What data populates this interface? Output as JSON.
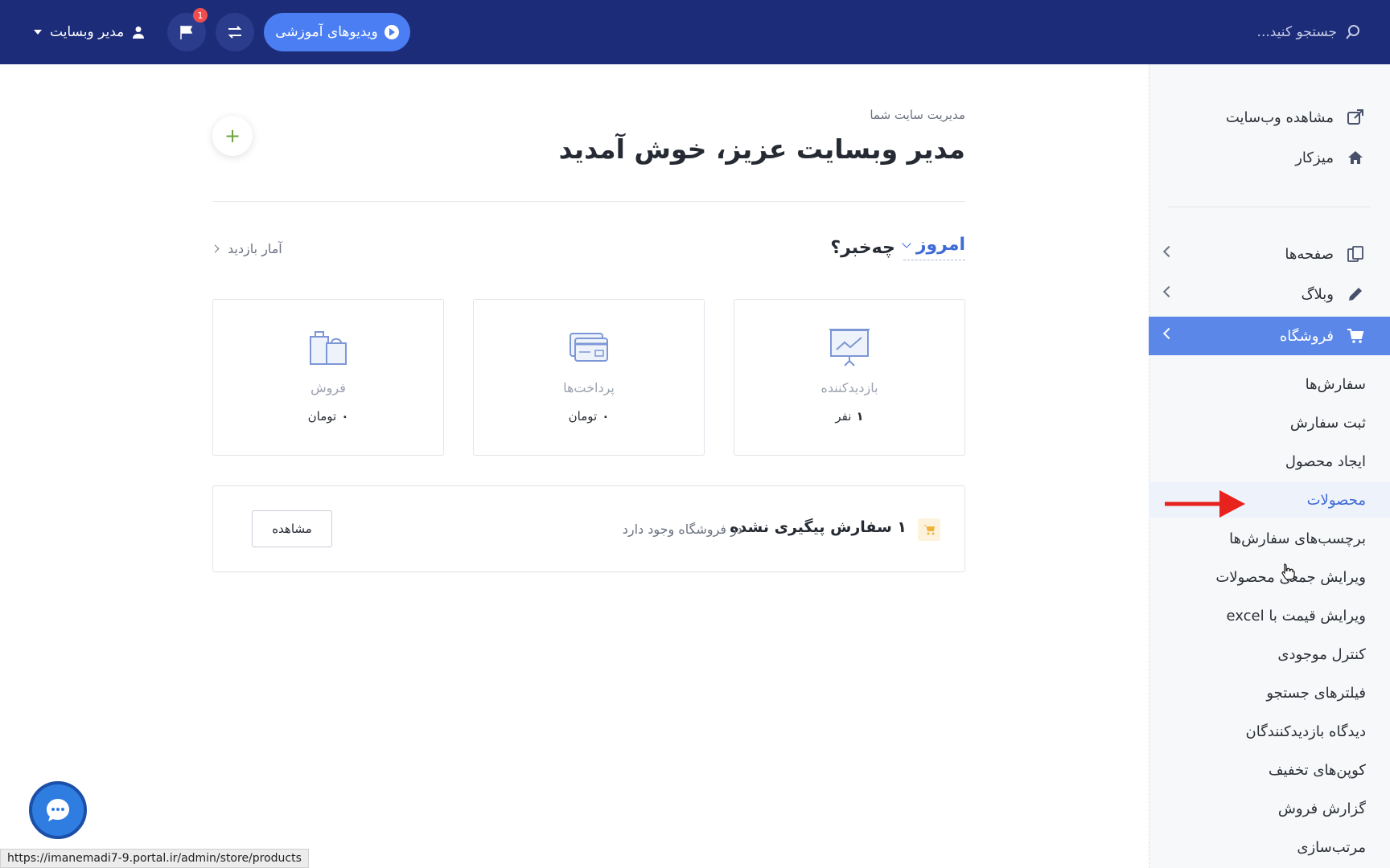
{
  "topbar": {
    "search_placeholder": "جستجو کنید...",
    "videos_button": "ویدیوهای آموزشی",
    "notification_count": "1",
    "user_name": "مدیر وبسایت"
  },
  "sidebar": {
    "top_items": [
      {
        "label": "مشاهده وب‌سایت",
        "icon": "external-link-icon"
      },
      {
        "label": "میزکار",
        "icon": "home-icon"
      }
    ],
    "nav_items": [
      {
        "label": "صفحه‌ها",
        "icon": "pages-icon"
      },
      {
        "label": "وبلاگ",
        "icon": "pencil-icon"
      },
      {
        "label": "فروشگاه",
        "icon": "cart-icon",
        "active": true
      }
    ],
    "store_submenu": [
      "سفارش‌ها",
      "ثبت سفارش",
      "ایجاد محصول",
      "محصولات",
      "برچسب‌های سفارش‌ها",
      "ویرایش جمعی محصولات",
      "ویرایش قیمت با excel",
      "کنترل موجودی",
      "فیلترهای جستجو",
      "دیدگاه بازدیدکنندگان",
      "کوپن‌های تخفیف",
      "گزارش فروش",
      "مرتب‌سازی"
    ],
    "hovered_item": "محصولات"
  },
  "main": {
    "subtitle": "مدیریت سایت شما",
    "welcome": "مدیر وبسایت عزیز، خوش آمدید",
    "add_button": "+",
    "period": "امروز",
    "news_title": "چه‌خبر؟",
    "visits_link": "آمار بازدید",
    "cards": [
      {
        "label": "بازدیدکننده",
        "value": "۱",
        "unit": "نفر",
        "icon": "presentation-chart-icon"
      },
      {
        "label": "پرداخت‌ها",
        "value": "۰",
        "unit": "تومان",
        "icon": "credit-card-icon"
      },
      {
        "label": "فروش",
        "value": "۰",
        "unit": "تومان",
        "icon": "shopping-bags-icon"
      }
    ],
    "orders_notice": {
      "title": "۱ سفارش پیگیری نشده",
      "subtitle": "در فروشگاه وجود دارد",
      "button": "مشاهده"
    }
  },
  "status_url": "https://imanemadi7-9.portal.ir/admin/store/products",
  "colors": {
    "topbar": "#1c2c78",
    "accent": "#4a7ef2",
    "active_sidebar": "#5a87e8",
    "badge": "#f04e4e",
    "annotation_arrow": "#e8231e"
  }
}
